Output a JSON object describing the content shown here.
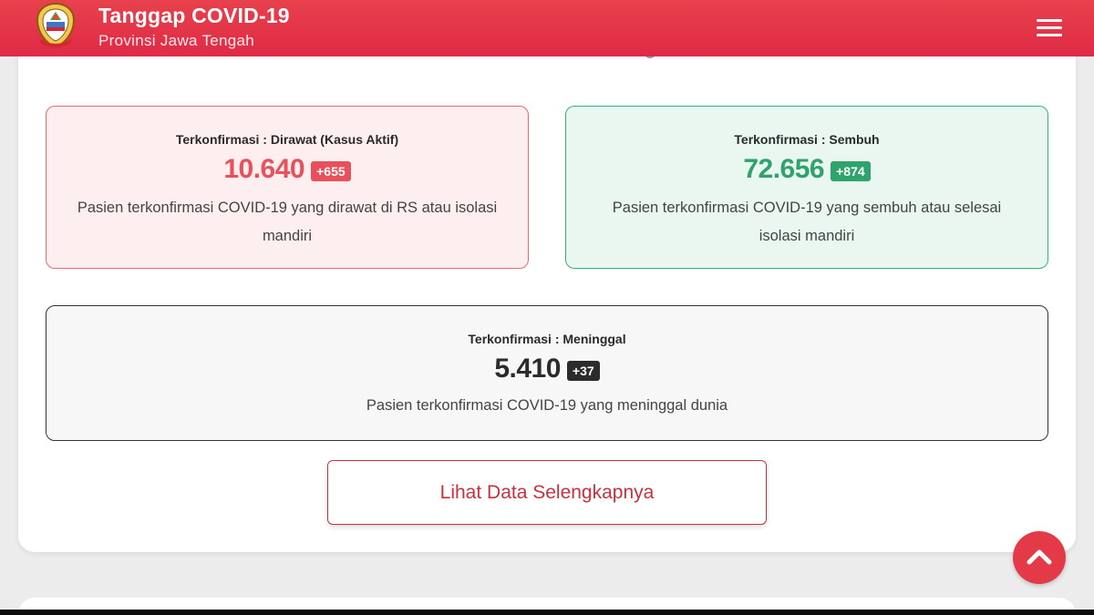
{
  "header": {
    "title": "Tanggap COVID-19",
    "subtitle": "Provinsi Jawa Tengah",
    "logo_icon": "jawa-tengah-emblem-icon",
    "menu_icon": "hamburger-menu-icon"
  },
  "stats": {
    "active": {
      "label": "Terkonfirmasi : Dirawat (Kasus Aktif)",
      "value": "10.640",
      "delta": "+655",
      "description": "Pasien terkonfirmasi COVID-19 yang dirawat di RS atau isolasi mandiri",
      "color": "#e8515b"
    },
    "recovered": {
      "label": "Terkonfirmasi : Sembuh",
      "value": "72.656",
      "delta": "+874",
      "description": "Pasien terkonfirmasi COVID-19 yang sembuh atau selesai isolasi mandiri",
      "color": "#2fa36c"
    },
    "deaths": {
      "label": "Terkonfirmasi : Meninggal",
      "value": "5.410",
      "delta": "+37",
      "description": "Pasien terkonfirmasi COVID-19 yang meninggal dunia",
      "color": "#2b2b2b"
    }
  },
  "actions": {
    "more_label": "Lihat Data Selengkapnya",
    "scroll_top_icon": "chevron-up-icon"
  },
  "colors": {
    "header": "#e02a46",
    "accent": "#c8303e"
  }
}
